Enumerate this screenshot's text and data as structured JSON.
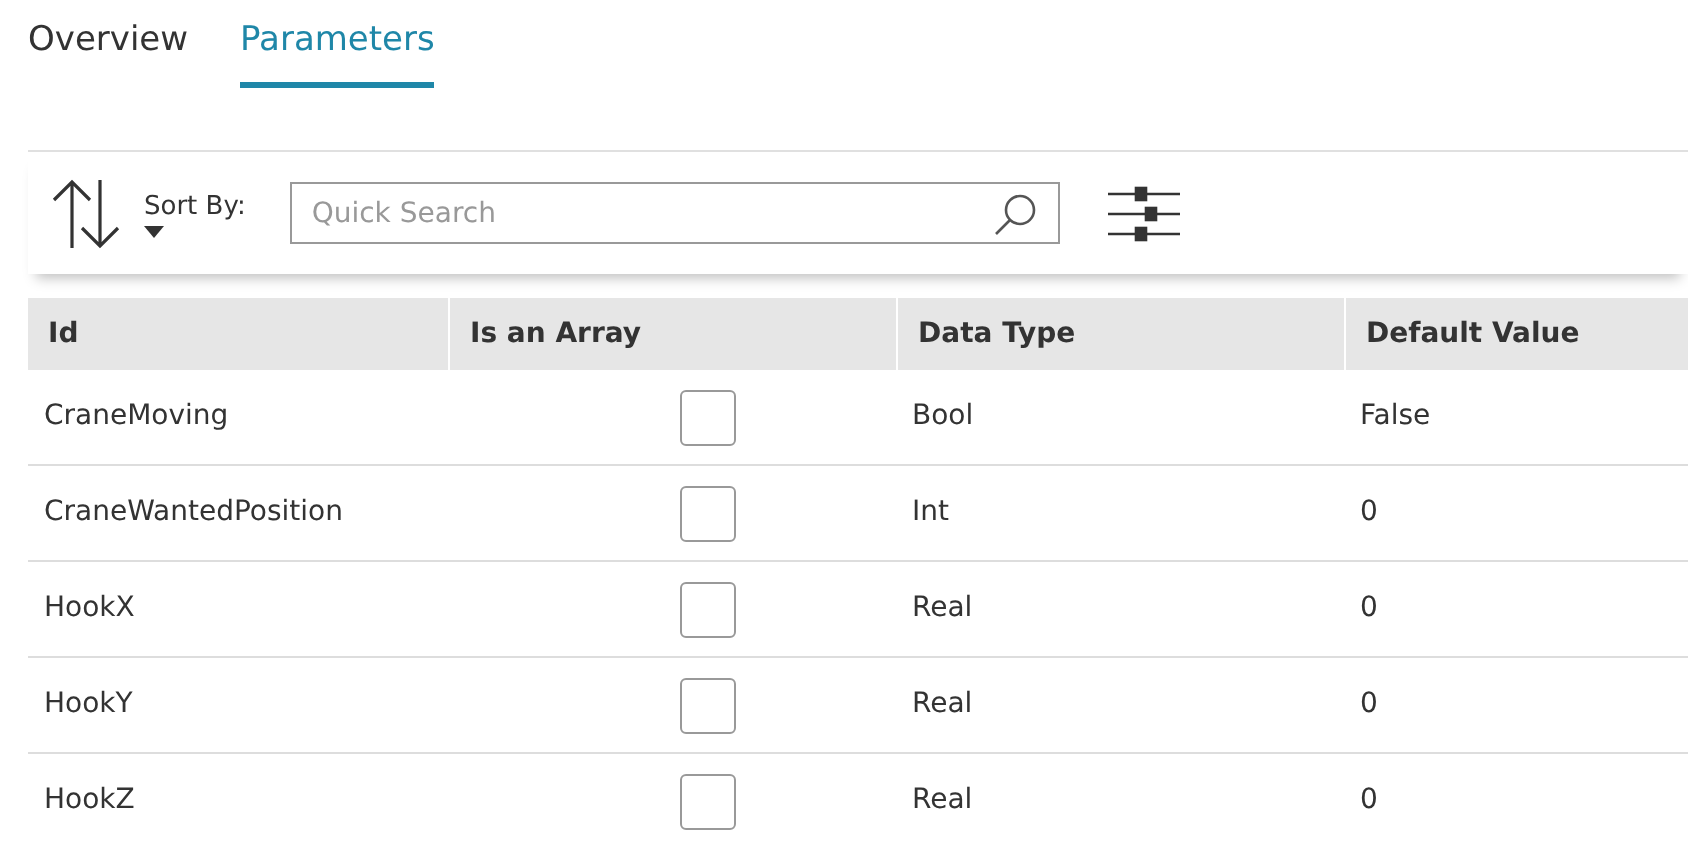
{
  "tabs": [
    {
      "label": "Overview",
      "selected": false
    },
    {
      "label": "Parameters",
      "selected": true
    }
  ],
  "toolbar": {
    "sort_label": "Sort By:",
    "search": {
      "placeholder": "Quick Search"
    }
  },
  "table": {
    "columns": [
      "Id",
      "Is an Array",
      "Data Type",
      "Default Value"
    ],
    "rows": [
      {
        "id": "CraneMoving",
        "is_array": false,
        "data_type": "Bool",
        "default_value": "False"
      },
      {
        "id": "CraneWantedPosition",
        "is_array": false,
        "data_type": "Int",
        "default_value": "0"
      },
      {
        "id": "HookX",
        "is_array": false,
        "data_type": "Real",
        "default_value": "0"
      },
      {
        "id": "HookY",
        "is_array": false,
        "data_type": "Real",
        "default_value": "0"
      },
      {
        "id": "HookZ",
        "is_array": false,
        "data_type": "Real",
        "default_value": "0"
      }
    ]
  }
}
